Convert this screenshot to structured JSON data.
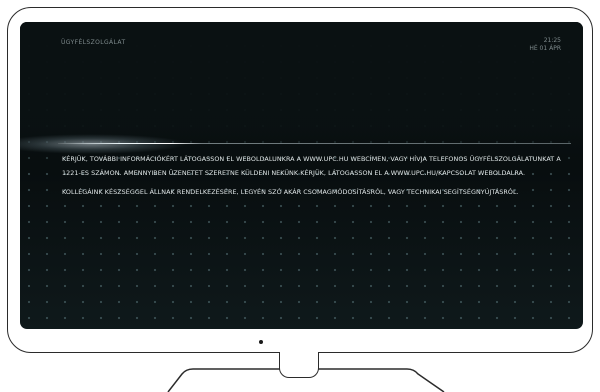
{
  "screen": {
    "header_title": "ÜGYFÉLSZOLGÁLAT",
    "clock_time": "21:25",
    "clock_date": "HÉ 01 ÁPR",
    "paragraphs": [
      "KÉRJÜK, TOVÁBBI INFORMÁCIÓKÉRT LÁTOGASSON EL WEBOLDALUNKRA A WWW.UPC.HU WEBCÍMEN, VAGY HÍVJA TELEFONOS ÜGYFÉLSZOLGÁLATUNKAT A 1221-ES SZÁMON. AMENNYIBEN ÜZENETET SZERETNE KÜLDENI NEKÜNK KÉRJÜK, LÁTOGASSON EL A WWW.UPC.HU/KAPCSOLAT WEBOLDALRA.",
      "KOLLÉGÁINK KÉSZSÉGGEL ÁLLNAK RENDELKEZÉSÉRE, LEGYÉN SZÓ AKÁR CSOMAGMÓDOSÍTÁSRÓL, VAGY TECHNIKAI SEGÍTSÉGNYÚJTÁSRÓL."
    ]
  },
  "colors": {
    "screen_bg": "#0a1112",
    "text": "#dfe6e7",
    "muted": "#7e8a8c",
    "frame": "#2b2b2b"
  }
}
